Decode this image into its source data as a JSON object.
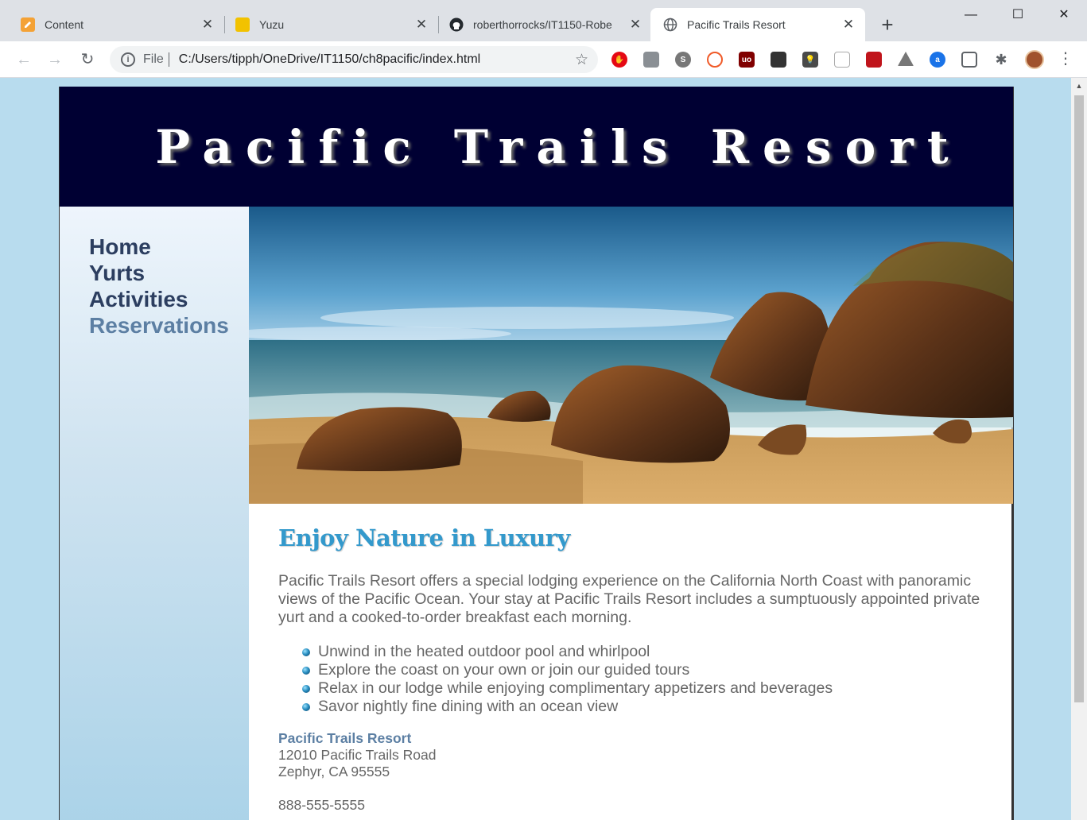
{
  "browser": {
    "tabs": [
      {
        "title": "Content",
        "favicon": "pencil-icon",
        "active": false
      },
      {
        "title": "Yuzu",
        "favicon": "yuzu-icon",
        "active": false
      },
      {
        "title": "roberthorrocks/IT1150-Robe",
        "favicon": "github-icon",
        "active": false
      },
      {
        "title": "Pacific Trails Resort",
        "favicon": "globe-icon",
        "active": true
      }
    ],
    "new_tab_label": "+",
    "window_controls": {
      "minimize": "—",
      "maximize": "☐",
      "close": "✕"
    },
    "address": {
      "scheme_label": "File",
      "url": "C:/Users/tipph/OneDrive/IT1150/ch8pacific/index.html"
    },
    "extensions": [
      "adblock-icon",
      "office-icon",
      "skype-icon",
      "extension-icon",
      "ublock-icon",
      "kindle-icon",
      "lightbulb-icon",
      "pocket-icon",
      "shield-icon",
      "drive-icon",
      "amazon-assistant-icon",
      "cast-icon",
      "puzzle-icon"
    ]
  },
  "site": {
    "header_title": "Pacific Trails Resort",
    "nav": [
      {
        "label": "Home",
        "current": false
      },
      {
        "label": "Yurts",
        "current": false
      },
      {
        "label": "Activities",
        "current": false
      },
      {
        "label": "Reservations",
        "current": true
      }
    ],
    "hero_alt": "beach-rocks-ocean-image",
    "heading": "Enjoy Nature in Luxury",
    "intro": "Pacific Trails Resort offers a special lodging experience on the California North Coast with panoramic views of the Pacific Ocean. Your stay at Pacific Trails Resort includes a sumptuously appointed private yurt and a cooked-to-order breakfast each morning.",
    "features": [
      "Unwind in the heated outdoor pool and whirlpool",
      "Explore the coast on your own or join our guided tours",
      "Relax in our lodge while enjoying complimentary appetizers and beverages",
      "Savor nightly fine dining with an ocean view"
    ],
    "contact": {
      "org": "Pacific Trails Resort",
      "street": "12010 Pacific Trails Road",
      "city": "Zephyr, CA 95555",
      "phone": "888-555-5555"
    }
  },
  "colors": {
    "header_bg": "#000033",
    "page_bg": "#b8dcee",
    "nav_text": "#2c3e60",
    "nav_current": "#5c7fa3",
    "heading": "#3399cc",
    "body_text": "#666666"
  }
}
